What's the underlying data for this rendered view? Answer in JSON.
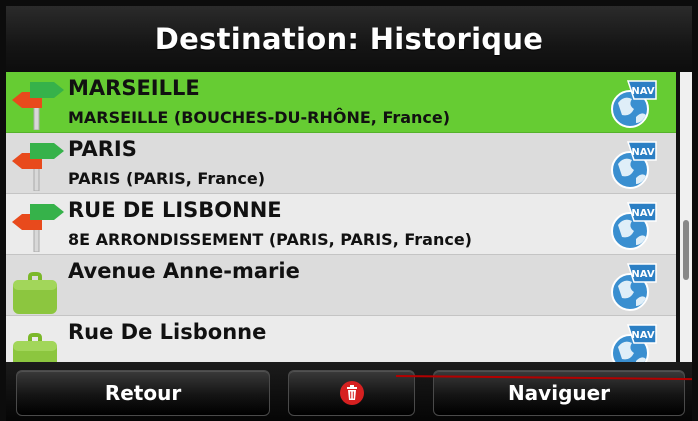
{
  "header": {
    "title": "Destination: Historique"
  },
  "history": [
    {
      "name": "MARSEILLE",
      "detail": "MARSEILLE (BOUCHES-DU-RHÔNE, France)",
      "icon": "signpost-icon",
      "selected": true
    },
    {
      "name": "PARIS",
      "detail": "PARIS (PARIS, France)",
      "icon": "signpost-icon",
      "selected": false
    },
    {
      "name": "RUE DE LISBONNE",
      "detail": "8E ARRONDISSEMENT (PARIS, PARIS, France)",
      "icon": "signpost-icon",
      "selected": false
    },
    {
      "name": "Avenue Anne-marie",
      "detail": "",
      "icon": "suitcase-icon",
      "selected": false
    },
    {
      "name": "Rue De Lisbonne",
      "detail": "",
      "icon": "suitcase-icon",
      "selected": false
    }
  ],
  "nav_badge": "NAV",
  "toolbar": {
    "back_label": "Retour",
    "delete_icon": "trash-icon",
    "navigate_label": "Naviguer"
  },
  "colors": {
    "selected_row": "#66cc33",
    "row": "#dcdcdc",
    "row_alt": "#ebebeb",
    "delete_icon": "#d62020",
    "annotation_line": "#b30000"
  }
}
